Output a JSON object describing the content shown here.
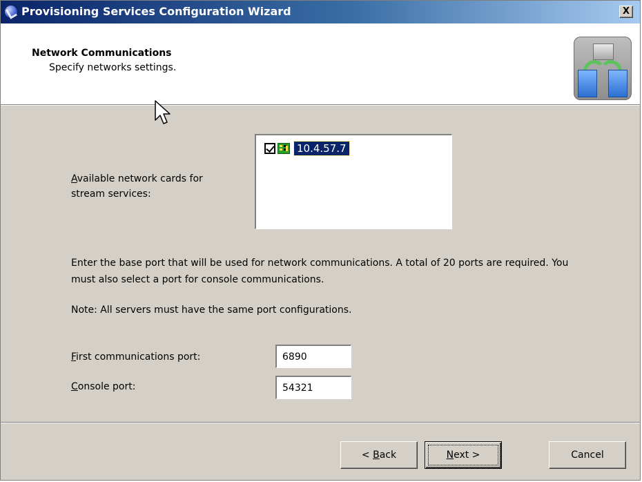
{
  "window": {
    "title": "Provisioning Services Configuration Wizard",
    "close_label": "X",
    "app_icon": "app-icon"
  },
  "header": {
    "title": "Network Communications",
    "subtitle": "Specify networks settings.",
    "image_icon": "network-transfer-icon"
  },
  "network_cards": {
    "label_mnemonic": "A",
    "label_rest_line1": "vailable network cards for",
    "label_line2": "stream services:",
    "items": [
      {
        "checked": true,
        "icon": "network-card-icon",
        "ip": "10.4.57.7",
        "selected": true
      }
    ]
  },
  "info": {
    "paragraph": "Enter the base port that will be used for network communications. A total of 20 ports are required. You must also select a port for console communications.",
    "note": "Note: All servers must have the same port configurations."
  },
  "ports": {
    "first_label_mnemonic": "F",
    "first_label_rest": "irst communications port:",
    "first_value": "6890",
    "console_label_mnemonic": "C",
    "console_label_rest": "onsole port:",
    "console_value": "54321"
  },
  "buttons": {
    "back_prefix": "< ",
    "back_mnemonic": "B",
    "back_rest": "ack",
    "next_mnemonic": "N",
    "next_rest": "ext >",
    "cancel": "Cancel"
  },
  "colors": {
    "dialog_bg": "#d4d0c8",
    "title_gradient_start": "#0a246a",
    "selection_bg": "#0a246a"
  }
}
